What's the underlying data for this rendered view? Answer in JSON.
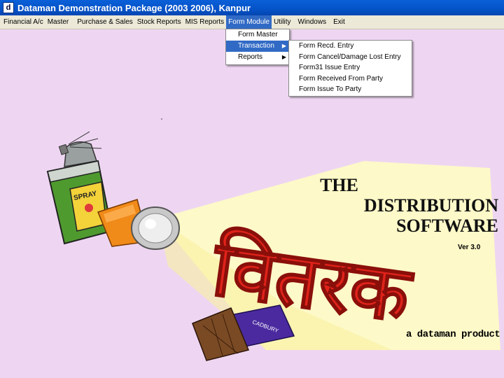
{
  "window": {
    "title": "Dataman Demonstration Package (2003 2006), Kanpur",
    "icon_letter": "d"
  },
  "menubar": {
    "items": [
      {
        "label": "Financial A/c"
      },
      {
        "label": "Master"
      },
      {
        "label": "Purchase & Sales"
      },
      {
        "label": "Stock Reports"
      },
      {
        "label": "MIS Reports"
      },
      {
        "label": "Form Module"
      },
      {
        "label": "Utility"
      },
      {
        "label": "Windows"
      },
      {
        "label": "Exit"
      }
    ]
  },
  "form_module_menu": {
    "items": [
      {
        "label": "Form Master"
      },
      {
        "label": "Transaction"
      },
      {
        "label": "Reports"
      }
    ]
  },
  "transaction_submenu": {
    "items": [
      {
        "label": "Form Recd. Entry"
      },
      {
        "label": "Form Cancel/Damage Lost Entry"
      },
      {
        "label": "Form31 Issue Entry"
      },
      {
        "label": "Form Received From Party"
      },
      {
        "label": "Form Issue To Party"
      }
    ]
  },
  "splash": {
    "line1": "THE",
    "line2": "DISTRIBUTION",
    "line3": "SOFTWARE",
    "version": "Ver 3.0",
    "tagline": "a dataman product",
    "spray_label": "SPRAY",
    "chocolate_label": "CADBURY",
    "logo_text": "वितरक"
  },
  "colors": {
    "background": "#eed6f2",
    "logo_red": "#e0231a",
    "highlight": "#316ac5"
  }
}
